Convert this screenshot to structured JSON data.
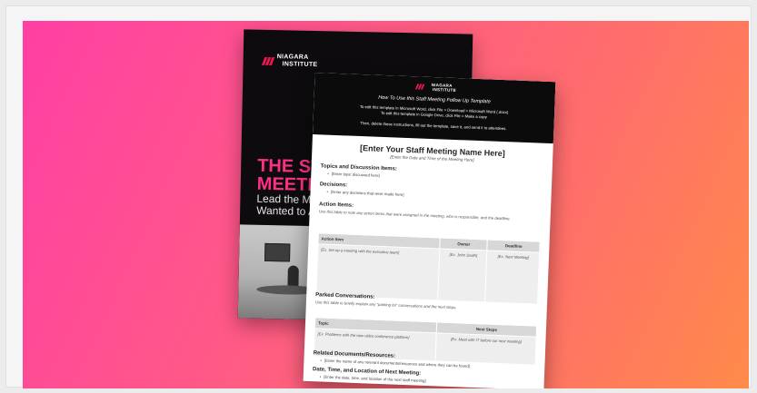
{
  "brand": {
    "line1": "NIAGARA",
    "line2": "INSTITUTE"
  },
  "back_cover": {
    "title_line1": "THE ST",
    "title_line2": "MEETI",
    "subtitle_line1": "Lead the Me",
    "subtitle_line2": "Wanted to A"
  },
  "doc": {
    "how_to": "How To Use this Staff Meeting Follow Up Template",
    "instructions": [
      "To edit this template in Microsoft Word, click File > Download > Microsoft Word (.docx)",
      "To edit this template in Google Drive, click File > Make a copy",
      "Then, delete these instructions, fill out the template, save it, and send it to attendees."
    ],
    "title": "[Enter Your Staff Meeting Name Here]",
    "subtitle": "[Enter the Date and Time of the Meeting Here]",
    "topics": {
      "heading": "Topics and Discussion Items:",
      "bullet": "[Enter topic discussed here]"
    },
    "decisions": {
      "heading": "Decisions:",
      "bullet": "[Enter any decisions that were made here]"
    },
    "action_items": {
      "heading": "Action Items:",
      "note": "Use this table to note any action items that were assigned in the meeting, who is responsible, and the deadline.",
      "columns": [
        "Action Item",
        "Owner",
        "Deadline"
      ],
      "row": [
        "[Ex. Set up a meeting with the executive team]",
        "[Ex. John Smith]",
        "[Ex. Next Meeting]"
      ]
    },
    "parked": {
      "heading": "Parked Conversations:",
      "note": "Use this table to briefly explain any \"parking lot\" conversations and the next steps.",
      "columns": [
        "Topic",
        "Next Steps"
      ],
      "row": [
        "[Ex. Problems with the new video conference platform]",
        "[Ex. Meet with IT before our next meeting]"
      ]
    },
    "related": {
      "heading": "Related Documents/Resources:",
      "bullet": "[Enter the name of any relevant documents/resources and where they can be found]"
    },
    "next_meeting": {
      "heading": "Date, Time, and Location of Next Meeting:",
      "bullet": "[Enter the date, time, and location of the next staff meeting]"
    }
  }
}
